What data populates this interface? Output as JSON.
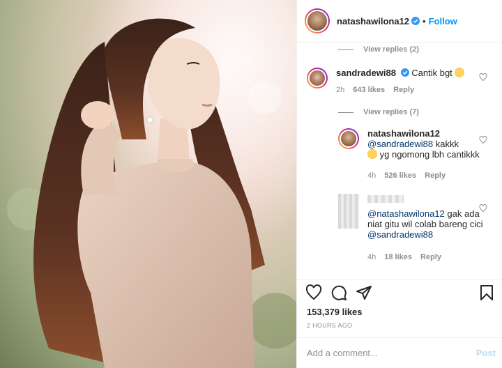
{
  "header": {
    "username": "natashawilona12",
    "separator": "•",
    "follow_label": "Follow"
  },
  "threads": [
    {
      "view_replies_label": "View replies (2)"
    },
    {
      "username": "sandradewi88",
      "text": "Cantik bgt",
      "emoji": "star-struck-emoji",
      "time": "2h",
      "likes": "643 likes",
      "reply_label": "Reply",
      "view_replies_label": "View replies (7)"
    }
  ],
  "replies": [
    {
      "username": "natashawilona12",
      "mention": "@sandradewi88",
      "text_a": "kakkk",
      "text_b": "yg ngomong lbh cantikkk",
      "emoji": "smiling-emoji",
      "time": "4h",
      "likes": "526 likes",
      "reply_label": "Reply"
    },
    {
      "mention": "@natashawilona12",
      "text": "gak ada niat gitu wil colab bareng cici",
      "mention_2": "@sandradewi88",
      "time": "4h",
      "likes": "18 likes",
      "reply_label": "Reply"
    }
  ],
  "actions": {
    "icons": [
      "heart-icon",
      "comment-icon",
      "share-icon",
      "bookmark-icon"
    ],
    "likes": "153,379 likes",
    "posted": "2 HOURS AGO"
  },
  "add_comment": {
    "placeholder": "Add a comment...",
    "post_label": "Post"
  },
  "colors": {
    "accent": "#0095f6",
    "post_disabled": "#b2dffc",
    "meta_grey": "#8e8e8e",
    "mention": "#00376b",
    "verified": "#3897f0"
  }
}
